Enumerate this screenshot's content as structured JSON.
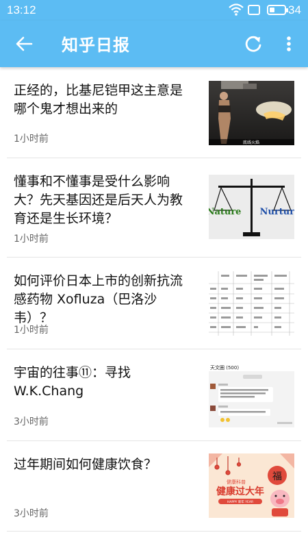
{
  "status_bar": {
    "time": "13:12",
    "battery_level": "34",
    "battery_fraction": 0.34,
    "icons": [
      "wifi-icon",
      "screen-icon",
      "battery-icon"
    ]
  },
  "app_bar": {
    "title": "知乎日报",
    "background_color": "#5cbcf3",
    "icons": [
      "back-arrow-icon",
      "refresh-icon",
      "more-vertical-icon"
    ]
  },
  "stories": [
    {
      "title": "正经的，比基尼铠甲这主意是哪个鬼才想出来的",
      "time": "1小时前",
      "thumbnail": {
        "caption": "底线火焰"
      }
    },
    {
      "title": "懂事和不懂事是受什么影响大？先天基因还是后天人为教育还是生长环境？",
      "time": "1小时前",
      "thumbnail": {
        "left_label": "Nature",
        "right_label": "Nurture"
      }
    },
    {
      "title": "如何评价日本上市的创新抗流感药物 Xofluza（巴洛沙韦）？",
      "time": "1小时前",
      "thumbnail": {}
    },
    {
      "title": "宇宙的往事⑪：寻找 W.K.Chang",
      "time": "3小时前",
      "thumbnail": {
        "header": "天文圈 (500)"
      }
    },
    {
      "title": "过年期间如何健康饮食？",
      "time": "3小时前",
      "thumbnail": {
        "line1": "健康科普",
        "line2": "健康过大年",
        "line3": "HAPPY 新年 YEAR"
      }
    }
  ]
}
